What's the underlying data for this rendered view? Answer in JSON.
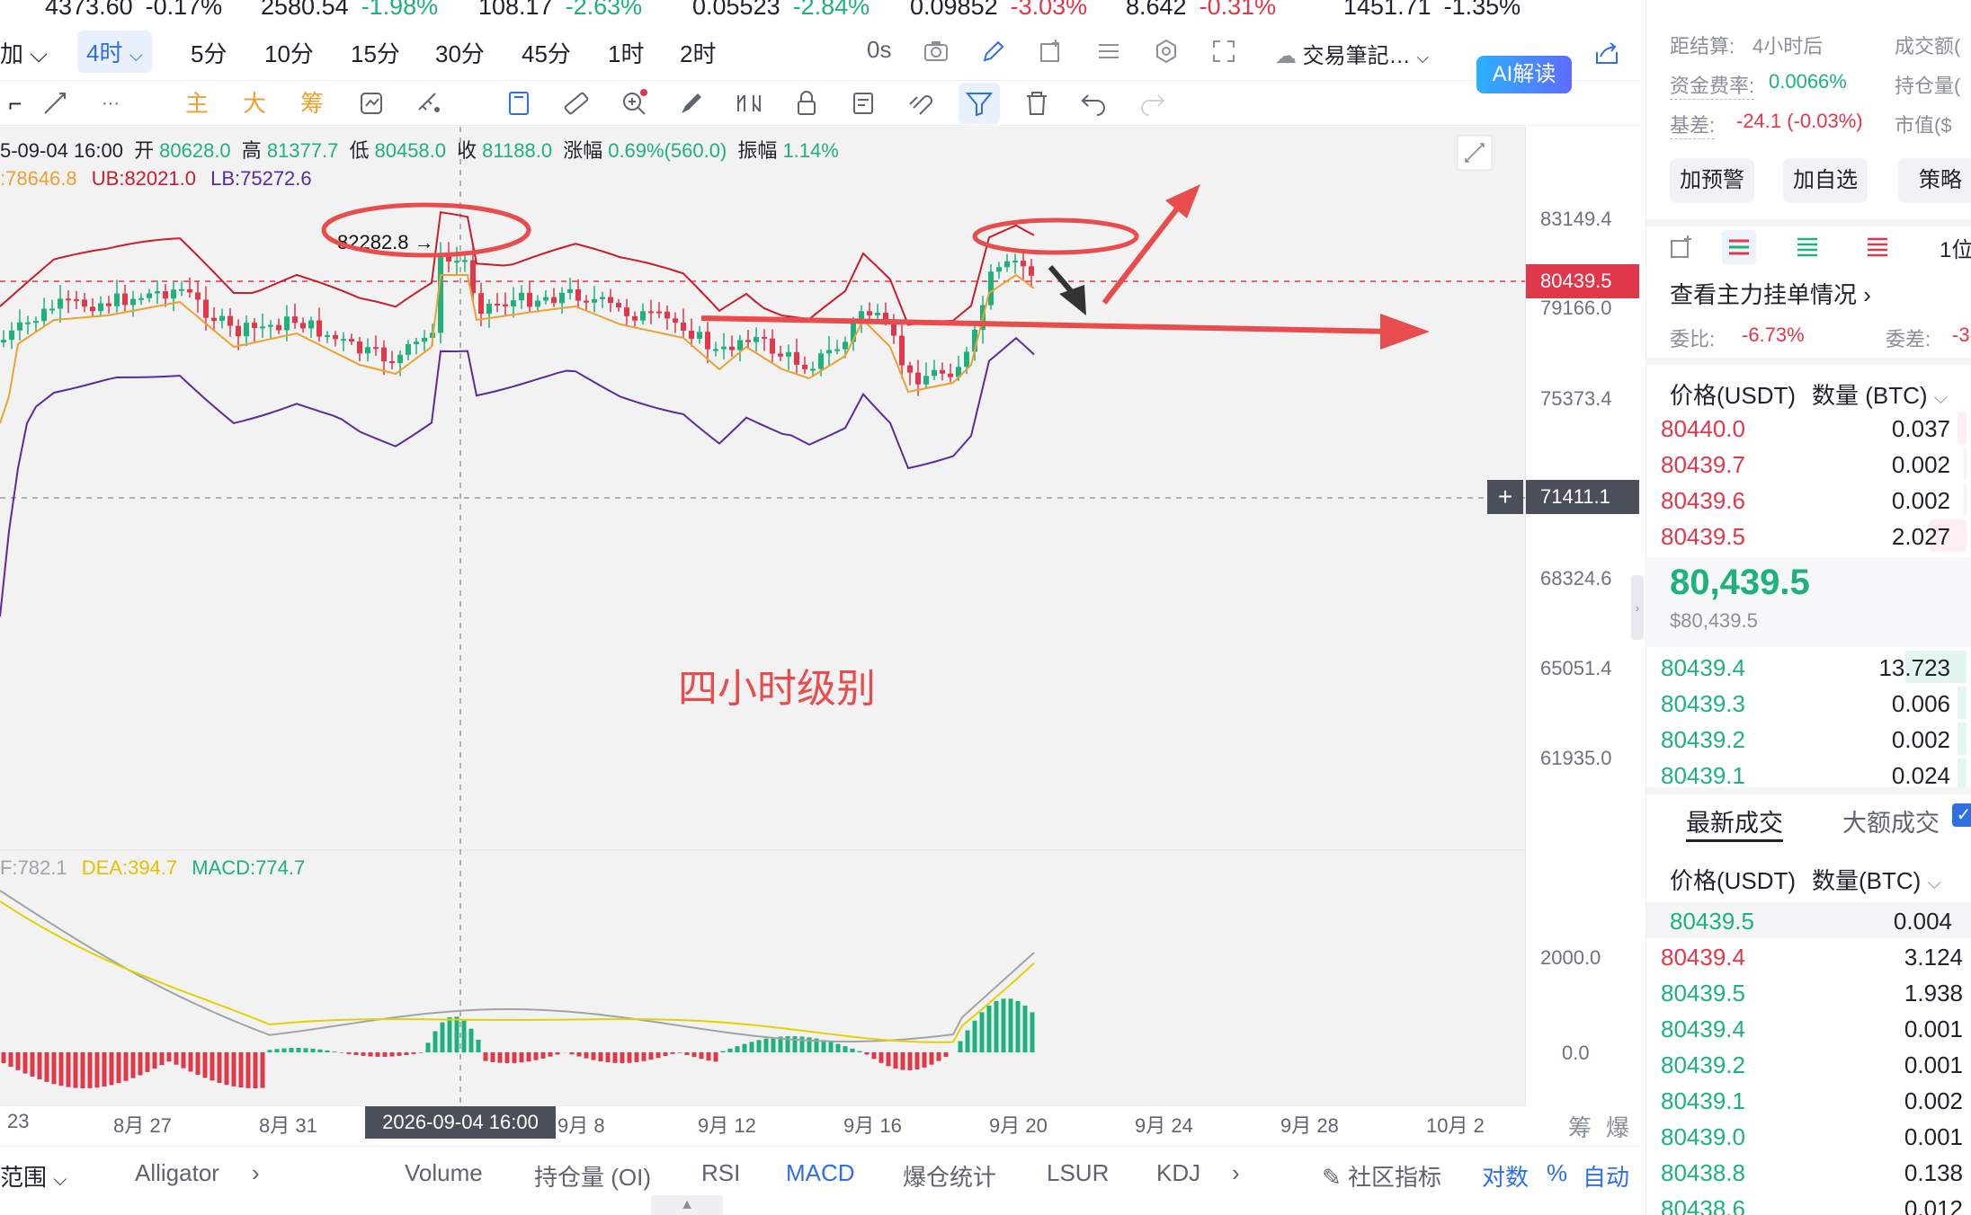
{
  "tickers": [
    {
      "price": "4373.60",
      "change": "-0.17%",
      "price_color": "#1f2329",
      "change_color": "#1f2329"
    },
    {
      "price": "2580.54",
      "change": "-1.98%",
      "price_color": "#1db27a",
      "change_color": "#1db27a"
    },
    {
      "price": "108.17",
      "change": "-2.63%",
      "price_color": "#1db27a",
      "change_color": "#1db27a"
    },
    {
      "price": "0.05523",
      "change": "-2.84%",
      "price_color": "#1db27a",
      "change_color": "#1db27a"
    },
    {
      "price": "0.09852",
      "change": "-3.03%",
      "price_color": "#e0384a",
      "change_color": "#e0384a"
    },
    {
      "price": "8.642",
      "change": "-0.31%",
      "price_color": "#e0384a",
      "change_color": "#e0384a"
    },
    {
      "price": "1451.71",
      "change": "-1.35%",
      "price_color": "#1f2329",
      "change_color": "#1f2329"
    }
  ],
  "toolbar": {
    "left_partial": "加",
    "active_interval": "4时",
    "intervals": [
      "5分",
      "10分",
      "15分",
      "30分",
      "45分",
      "1时",
      "2时"
    ],
    "countdown": "0s",
    "notes_label": "交易筆記…",
    "ai_label": "AI解读"
  },
  "drawing_tools": {
    "main": "主",
    "big": "大",
    "chip": "筹",
    "more": "···"
  },
  "ohlc": {
    "date": "5-09-04 16:00",
    "open_label": "开",
    "open": "80628.0",
    "high_label": "高",
    "high": "81377.7",
    "low_label": "低",
    "low": "80458.0",
    "close_label": "收",
    "close": "81188.0",
    "change_label": "涨幅",
    "change": "0.69%(560.0)",
    "amp_label": "振幅",
    "amp": "1.14%"
  },
  "bollinger": {
    "mid": ":78646.8",
    "ub": "UB:82021.0",
    "lb": "LB:75272.6"
  },
  "macd": {
    "dif": "F:782.1",
    "dea": "DEA:394.7",
    "macd": "MACD:774.7"
  },
  "price_axis": [
    "83149.4",
    "79166.0",
    "75373.4",
    "68324.6",
    "65051.4",
    "61935.0",
    "2000.0",
    "0.0"
  ],
  "current_price_tag": "80439.5",
  "cursor_price_tag": "71411.1",
  "peak_label": "82282.8 →",
  "annotation_text": "四小时级别",
  "x_axis": [
    "23",
    "8月 27",
    "8月 31",
    "9月 8",
    "9月 12",
    "9月 16",
    "9月 20",
    "9月 24",
    "9月 28",
    "10月 2"
  ],
  "x_cursor": "2026-09-04 16:00",
  "x_right_icons": [
    "筹",
    "爆"
  ],
  "indicators": {
    "range": "范围",
    "alligator": "Alligator",
    "items": [
      "Volume",
      "持仓量 (OI)",
      "RSI",
      "MACD",
      "爆仓统计",
      "LSUR",
      "KDJ"
    ],
    "active": "MACD",
    "community": "社区指标",
    "log": "对数",
    "pct": "%",
    "auto": "自动"
  },
  "right_panel": {
    "settle_label": "距结算:",
    "settle_value": "4小时后",
    "turnover_label": "成交额(",
    "funding_label": "资金费率:",
    "funding_value": "0.0066%",
    "oi_label": "持仓量(",
    "basis_label": "基差:",
    "basis_value": "-24.1 (-0.03%)",
    "mcap_label": "市值($",
    "btn_alert": "加预警",
    "btn_watch": "加自选",
    "btn_strategy": "策略",
    "depth_label": "1位",
    "orders_link": "查看主力挂单情况",
    "ratio_label": "委比:",
    "ratio_value": "-6.73%",
    "diff_label": "委差:",
    "diff_value": "-3",
    "book_header_price": "价格(USDT)",
    "book_header_qty": "数量 (BTC)",
    "asks": [
      {
        "price": "80440.0",
        "qty": "0.037",
        "fill": 0.03
      },
      {
        "price": "80439.7",
        "qty": "0.002",
        "fill": 0.01
      },
      {
        "price": "80439.6",
        "qty": "0.002",
        "fill": 0.01
      },
      {
        "price": "80439.5",
        "qty": "2.027",
        "fill": 0.12
      }
    ],
    "last_price": "80,439.5",
    "last_usd": "$80,439.5",
    "bids": [
      {
        "price": "80439.4",
        "qty": "13.723",
        "fill": 0.2
      },
      {
        "price": "80439.3",
        "qty": "0.006",
        "fill": 0.03
      },
      {
        "price": "80439.2",
        "qty": "0.002",
        "fill": 0.03
      },
      {
        "price": "80439.1",
        "qty": "0.024",
        "fill": 0.03
      }
    ],
    "trades_tab": "最新成交",
    "large_tab": "大额成交",
    "trades_header_price": "价格(USDT)",
    "trades_header_qty": "数量(BTC)",
    "trades": [
      {
        "price": "80439.5",
        "qty": "0.004",
        "color": "#1db27a"
      },
      {
        "price": "80439.4",
        "qty": "3.124",
        "color": "#e0384a"
      },
      {
        "price": "80439.5",
        "qty": "1.938",
        "color": "#1db27a"
      },
      {
        "price": "80439.4",
        "qty": "0.001",
        "color": "#1db27a"
      },
      {
        "price": "80439.2",
        "qty": "0.001",
        "color": "#1db27a"
      },
      {
        "price": "80439.1",
        "qty": "0.002",
        "color": "#1db27a"
      },
      {
        "price": "80439.0",
        "qty": "0.001",
        "color": "#1db27a"
      },
      {
        "price": "80438.8",
        "qty": "0.138",
        "color": "#1db27a"
      },
      {
        "price": "80438.6",
        "qty": "0.012",
        "color": "#1db27a"
      }
    ]
  },
  "colors": {
    "up": "#1db27a",
    "down": "#e0384a",
    "accent": "#2f6fe4",
    "ub": "#c81e2c",
    "lb": "#5b2a9e",
    "mid": "#f0a030",
    "annot": "#e84c4c"
  }
}
